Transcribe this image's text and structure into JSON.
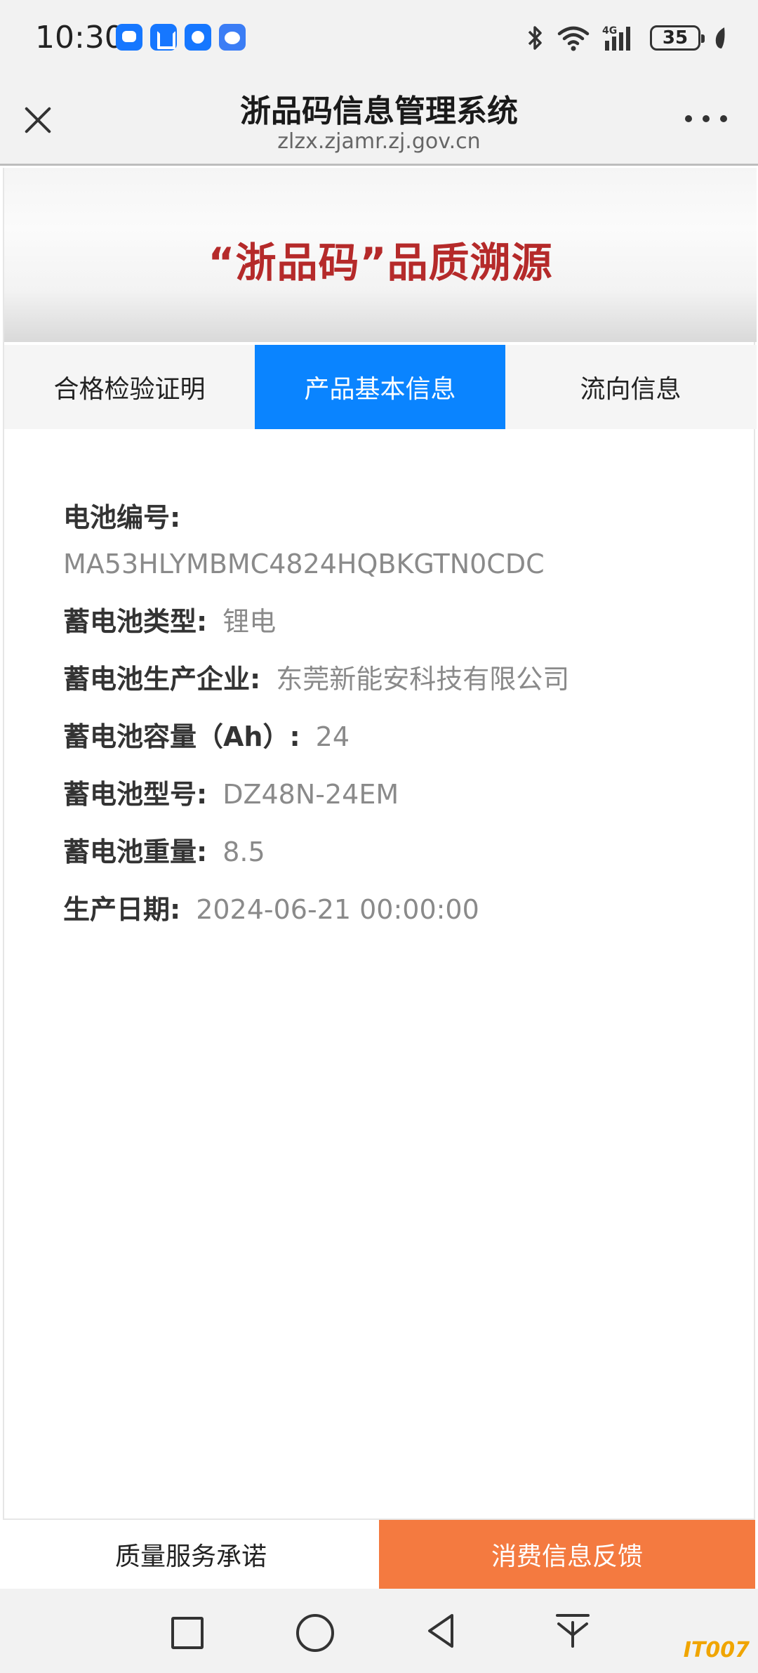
{
  "status_bar": {
    "time": "10:30",
    "battery": "35",
    "notification_icons": [
      "message-icon",
      "alipay-icon",
      "camera-app-icon",
      "chat-bot-icon"
    ],
    "system_icons": [
      "bluetooth-icon",
      "wifi-icon",
      "signal-4g-icon",
      "battery-icon",
      "leaf-icon"
    ]
  },
  "header": {
    "title": "浙品码信息管理系统",
    "url": "zlzx.zjamr.zj.gov.cn"
  },
  "banner": {
    "text": "“浙品码”品质溯源"
  },
  "tabs": [
    {
      "label": "合格检验证明",
      "active": false
    },
    {
      "label": "产品基本信息",
      "active": true
    },
    {
      "label": "流向信息",
      "active": false
    }
  ],
  "info": {
    "battery_number_label": "电池编号:",
    "battery_number": "MA53HLYMBMC4824HQBKGTN0CDC",
    "type_label": "蓄电池类型:",
    "type": "锂电",
    "maker_label": "蓄电池生产企业:",
    "maker": "东莞新能安科技有限公司",
    "capacity_label": "蓄电池容量（Ah）:",
    "capacity": "24",
    "model_label": "蓄电池型号:",
    "model": "DZ48N-24EM",
    "weight_label": "蓄电池重量:",
    "weight": "8.5",
    "date_label": "生产日期:",
    "date": "2024-06-21 00:00:00"
  },
  "bottom_bar": {
    "promise_label": "质量服务承诺",
    "feedback_label": "消费信息反馈"
  },
  "watermark": "IT007",
  "colors": {
    "tab_active": "#0a84ff",
    "banner_text": "#b52a2a",
    "feedback_button": "#f47a40"
  }
}
